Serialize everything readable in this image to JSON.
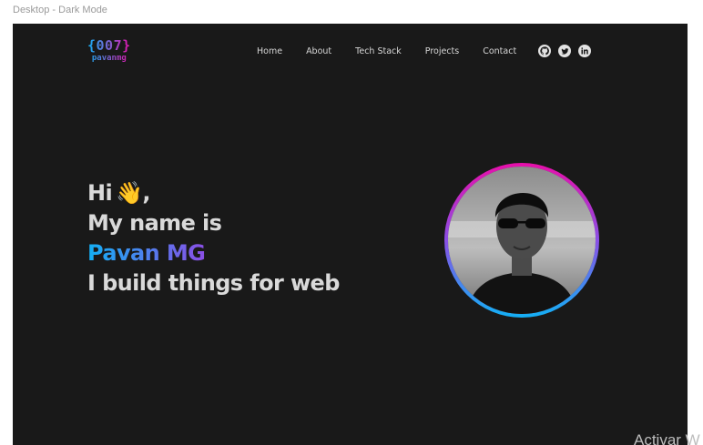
{
  "canvas": {
    "frame_label": "Desktop - Dark Mode"
  },
  "logo": {
    "main": "{007}",
    "sub": "pavanmg"
  },
  "nav": {
    "links": [
      "Home",
      "About",
      "Tech Stack",
      "Projects",
      "Contact"
    ],
    "social_icons": [
      "github-icon",
      "twitter-icon",
      "linkedin-icon"
    ]
  },
  "hero": {
    "greeting": "Hi",
    "wave_emoji": "👋",
    "greeting_suffix": ",",
    "line2": "My name is",
    "name": "Pavan MG",
    "line4": "I build things for web"
  },
  "profile": {
    "image": "profile-photo"
  },
  "colors": {
    "background": "#191919",
    "gradient_start": "#13b0f5",
    "gradient_end": "#e70faa",
    "text": "#d9d9d9"
  },
  "watermark": {
    "text": "Activar W"
  }
}
